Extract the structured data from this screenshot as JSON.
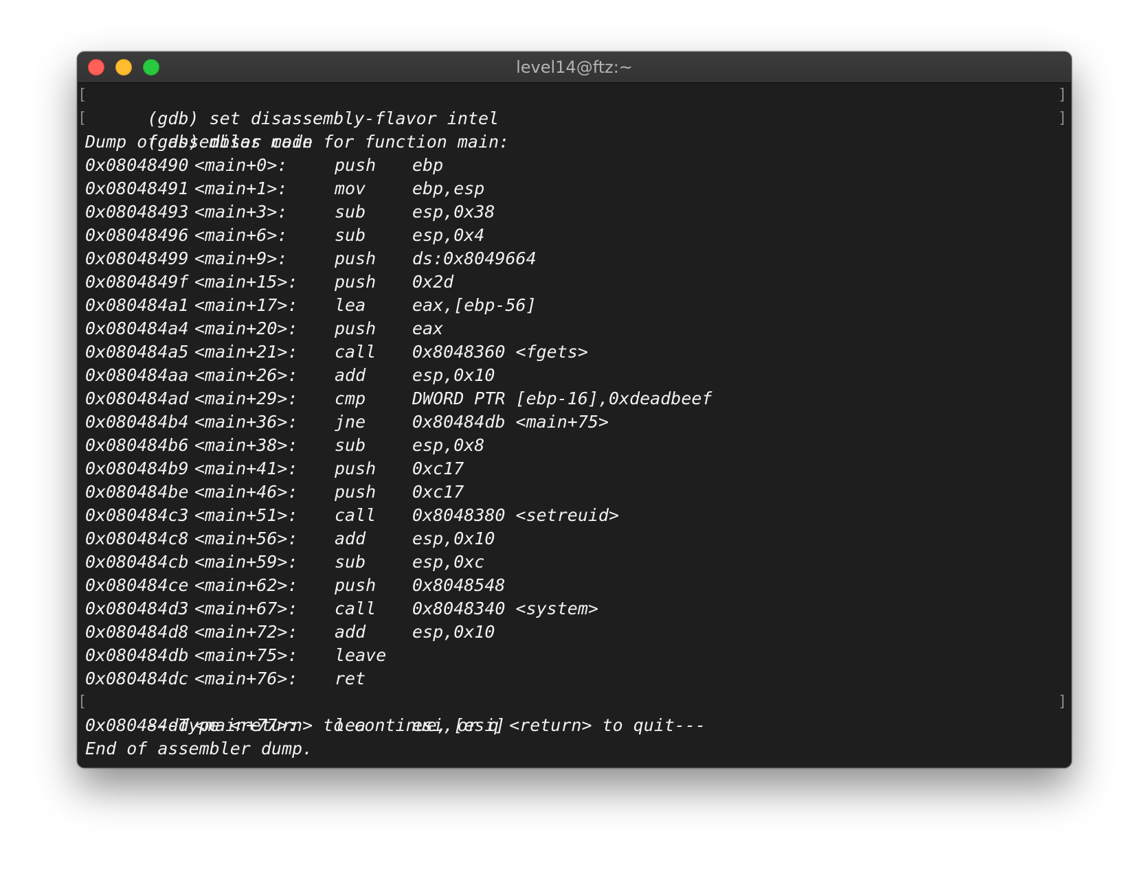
{
  "window": {
    "title": "level14@ftz:~"
  },
  "terminal": {
    "commands": [
      "(gdb) set disassembly-flavor intel",
      "(gdb) disas main"
    ],
    "dump_header": "Dump of assembler code for function main:",
    "instructions": [
      {
        "addr": "0x08048490",
        "sym": "<main+0>:",
        "op": "push",
        "args": "ebp"
      },
      {
        "addr": "0x08048491",
        "sym": "<main+1>:",
        "op": "mov",
        "args": "ebp,esp"
      },
      {
        "addr": "0x08048493",
        "sym": "<main+3>:",
        "op": "sub",
        "args": "esp,0x38"
      },
      {
        "addr": "0x08048496",
        "sym": "<main+6>:",
        "op": "sub",
        "args": "esp,0x4"
      },
      {
        "addr": "0x08048499",
        "sym": "<main+9>:",
        "op": "push",
        "args": "ds:0x8049664"
      },
      {
        "addr": "0x0804849f",
        "sym": "<main+15>:",
        "op": "push",
        "args": "0x2d"
      },
      {
        "addr": "0x080484a1",
        "sym": "<main+17>:",
        "op": "lea",
        "args": "eax,[ebp-56]"
      },
      {
        "addr": "0x080484a4",
        "sym": "<main+20>:",
        "op": "push",
        "args": "eax"
      },
      {
        "addr": "0x080484a5",
        "sym": "<main+21>:",
        "op": "call",
        "args": "0x8048360 <fgets>"
      },
      {
        "addr": "0x080484aa",
        "sym": "<main+26>:",
        "op": "add",
        "args": "esp,0x10"
      },
      {
        "addr": "0x080484ad",
        "sym": "<main+29>:",
        "op": "cmp",
        "args": "DWORD PTR [ebp-16],0xdeadbeef"
      },
      {
        "addr": "0x080484b4",
        "sym": "<main+36>:",
        "op": "jne",
        "args": "0x80484db <main+75>"
      },
      {
        "addr": "0x080484b6",
        "sym": "<main+38>:",
        "op": "sub",
        "args": "esp,0x8"
      },
      {
        "addr": "0x080484b9",
        "sym": "<main+41>:",
        "op": "push",
        "args": "0xc17"
      },
      {
        "addr": "0x080484be",
        "sym": "<main+46>:",
        "op": "push",
        "args": "0xc17"
      },
      {
        "addr": "0x080484c3",
        "sym": "<main+51>:",
        "op": "call",
        "args": "0x8048380 <setreuid>"
      },
      {
        "addr": "0x080484c8",
        "sym": "<main+56>:",
        "op": "add",
        "args": "esp,0x10"
      },
      {
        "addr": "0x080484cb",
        "sym": "<main+59>:",
        "op": "sub",
        "args": "esp,0xc"
      },
      {
        "addr": "0x080484ce",
        "sym": "<main+62>:",
        "op": "push",
        "args": "0x8048548"
      },
      {
        "addr": "0x080484d3",
        "sym": "<main+67>:",
        "op": "call",
        "args": "0x8048340 <system>"
      },
      {
        "addr": "0x080484d8",
        "sym": "<main+72>:",
        "op": "add",
        "args": "esp,0x10"
      },
      {
        "addr": "0x080484db",
        "sym": "<main+75>:",
        "op": "leave",
        "args": ""
      },
      {
        "addr": "0x080484dc",
        "sym": "<main+76>:",
        "op": "ret",
        "args": ""
      }
    ],
    "pager_prompt": "---Type <return> to continue, or q <return> to quit---",
    "instructions_after": [
      {
        "addr": "0x080484dd",
        "sym": "<main+77>:",
        "op": "lea",
        "args": "esi,[esi]"
      }
    ],
    "dump_footer": "End of assembler dump."
  },
  "colors": {
    "close": "#fe5f57",
    "minimize": "#febc2e",
    "maximize": "#28c840",
    "terminal_bg": "#1e1e1e",
    "text": "#f2f2f2"
  }
}
